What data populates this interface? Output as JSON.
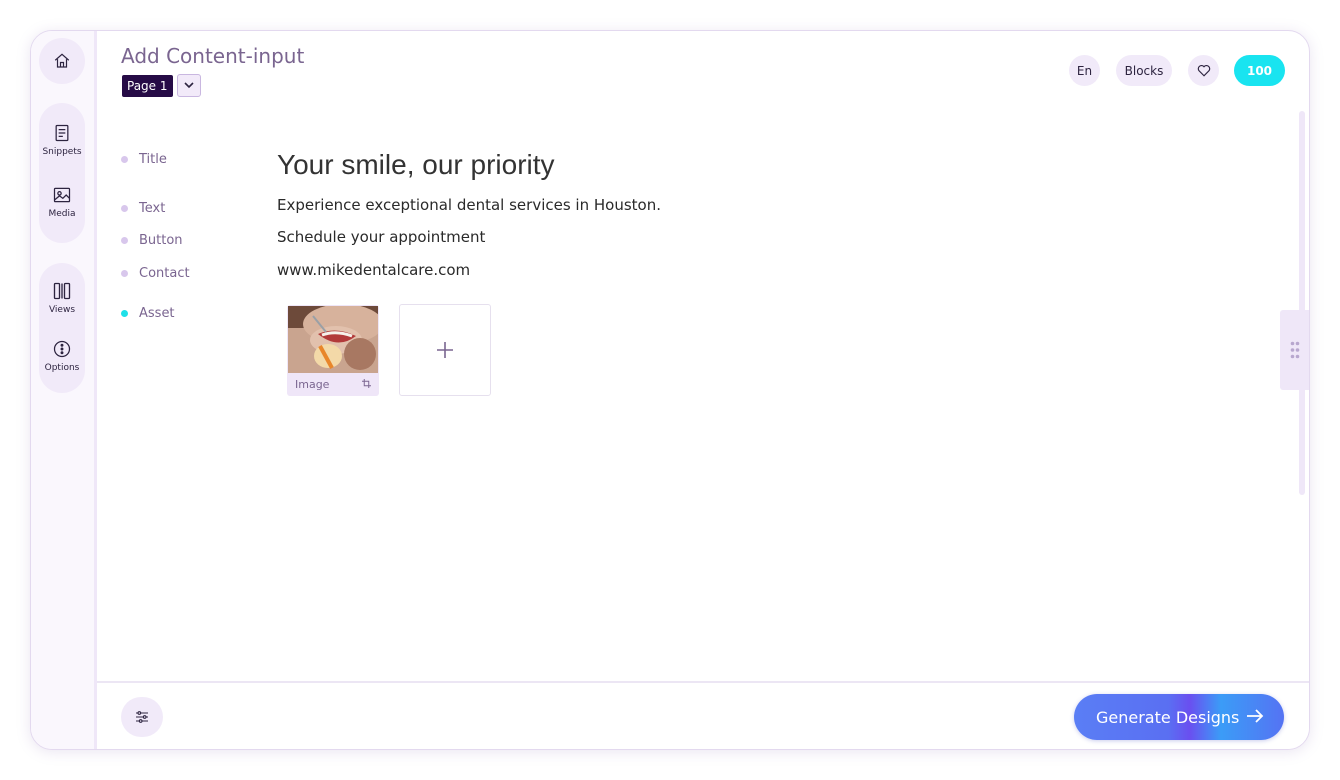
{
  "sidebar": {
    "home_icon": "home-icon",
    "snippets_label": "Snippets",
    "media_label": "Media",
    "views_label": "Views",
    "options_label": "Options"
  },
  "header": {
    "title": "Add Content-input",
    "page_label": "Page 1",
    "language": "En",
    "blocks_label": "Blocks",
    "credits": "100"
  },
  "fields": [
    {
      "label": "Title",
      "value": "Your smile, our priority"
    },
    {
      "label": "Text",
      "value": "Experience exceptional dental services in Houston."
    },
    {
      "label": "Button",
      "value": "Schedule your appointment"
    },
    {
      "label": "Contact",
      "value": "www.mikedentalcare.com"
    },
    {
      "label": "Asset",
      "value": ""
    }
  ],
  "asset": {
    "caption": "Image",
    "add_symbol": "+"
  },
  "footer": {
    "generate_label": "Generate Designs"
  },
  "colors": {
    "accent": "#19e4f0",
    "dark": "#260b46",
    "muted": "#7a6590"
  }
}
